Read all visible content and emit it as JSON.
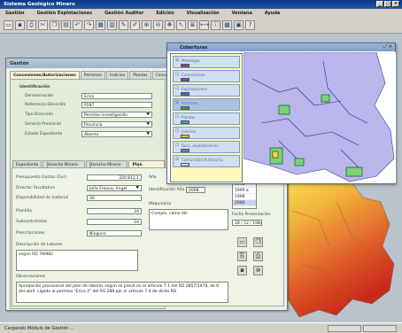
{
  "app": {
    "title": "Sistema Geológico Minero",
    "window_buttons": [
      "_",
      "□",
      "×"
    ]
  },
  "menu": [
    "Gestión",
    "Gestión Explotaciones",
    "Gestión Auditor",
    "Edición",
    "Visualización",
    "Ventana",
    "Ayuda"
  ],
  "toolbar_icons": [
    "open-icon",
    "save-icon",
    "print-icon",
    "cut-icon",
    "copy-icon",
    "paste-icon",
    "undo-icon",
    "redo-icon",
    "form-icon",
    "grid-icon",
    "edit-icon",
    "pencil-icon",
    "zoom-in-icon",
    "zoom-out-icon",
    "pan-icon",
    "select-icon",
    "layers-icon",
    "measure-icon",
    "identify-icon",
    "map-icon",
    "info-icon",
    "help-icon"
  ],
  "form": {
    "window_title": "Gestión",
    "main_tabs": [
      "Concesiones/Autorizaciones",
      "Permisos",
      "Indicios",
      "Plantas",
      "Consultas"
    ],
    "section": "Identificación",
    "fields": [
      {
        "label": "Denominación",
        "value": "Erica"
      },
      {
        "label": "Referencia Dirección",
        "value": "P287"
      },
      {
        "label": "Tipo Dirección",
        "value": "Permiso investigación"
      },
      {
        "label": "Servicio Provincial",
        "value": "Provincia"
      },
      {
        "label": "Estado Expediente",
        "value": "Abierto"
      }
    ],
    "sub_tabs": [
      "Expediente",
      "Derecho Minero 1",
      "Derecho Minero 2",
      "Plan Labores"
    ],
    "plan": {
      "presupuesto_label": "Presupuesto Gastos (Eur)",
      "presupuesto_value": "320.812,1",
      "director_label": "Director Facultativo",
      "director_value": "Jaifa Emuna, Angel",
      "disponibilidad_label": "Disponibilidad de material",
      "disponibilidad_value": "30",
      "plantilla_label": "Plantilla",
      "plantilla_value": "24",
      "subcontratistas_label": "Subcontratistas",
      "subcontratistas_value": "24",
      "prescripciones_label": "Prescripciones",
      "prescripciones_value": "Ninguna",
      "ano_label": "Año",
      "identificacion_label": "Identificación Año",
      "identificacion_value": "2008",
      "maquinaria_label": "Maquinaria",
      "maquinaria_value": "Cumple, camo Völ",
      "years": [
        "1998",
        "1999 a",
        "1998",
        "2000"
      ],
      "fecha_label": "Fecha Presentación",
      "fecha_value": "28 / 12 / 1984",
      "descripcion_label": "Descripción de Labores",
      "descripcion_value": "según RD 78/982",
      "observaciones_label": "Observaciones",
      "observaciones_value": "Aprobación provisional del plan de labores según se prevé en el artículo 7.1 del RD 2857/1978, de 8 del abril. Ligado al permiso \"Erica 2\" del P.E.288 por el artículo 7.4 de dicho RD"
    }
  },
  "map": {
    "window_title": "Coberturas",
    "layers": [
      {
        "name": "Metalogía",
        "checked": true,
        "color": "#6a4cc2",
        "selected": false
      },
      {
        "name": "Concesiones",
        "checked": false,
        "color": "#8a3ad0",
        "selected": false
      },
      {
        "name": "Explotaciones",
        "checked": false,
        "color": "#5a5ad8",
        "selected": false
      },
      {
        "name": "Permisos",
        "checked": true,
        "color": "#3a9a3a",
        "selected": true
      },
      {
        "name": "Plantas",
        "checked": false,
        "color": "#4aa4c8",
        "selected": false
      },
      {
        "name": "Indicios",
        "checked": false,
        "color": "#e0c23a",
        "selected": false
      },
      {
        "name": "Secc. explotaciones",
        "checked": false,
        "color": "#5a8ad8",
        "selected": false
      },
      {
        "name": "Comunidad Autónoma",
        "checked": true,
        "color": "#c8d4ee",
        "selected": false
      }
    ]
  },
  "status": {
    "text": "Cargando Módulo de Gestión ..."
  }
}
